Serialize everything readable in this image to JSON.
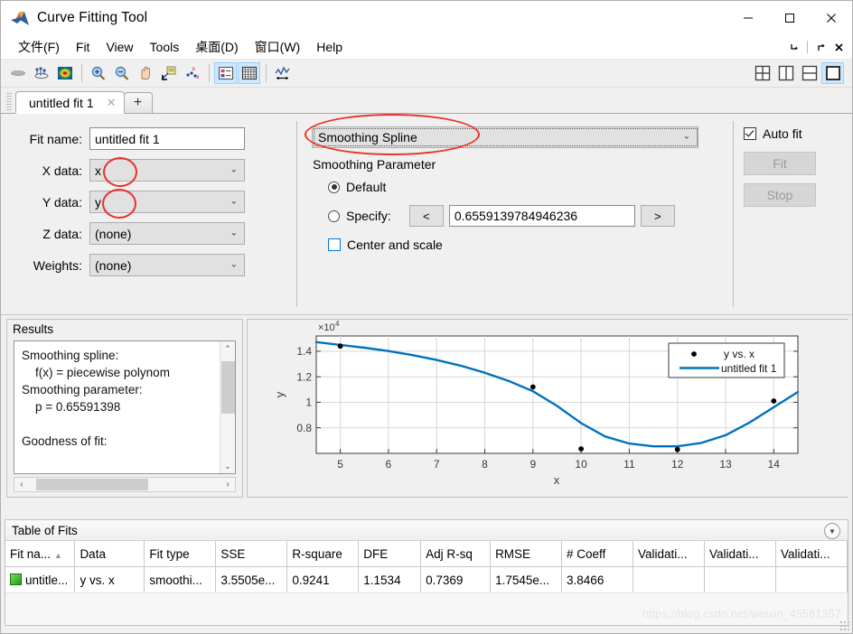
{
  "window": {
    "title": "Curve Fitting Tool",
    "icon": "matlab-icon",
    "minimize": "—",
    "maximize": "□",
    "close": "✕"
  },
  "menu": {
    "items": [
      {
        "label": "文件(F)",
        "name": "menu-file"
      },
      {
        "label": "Fit",
        "name": "menu-fit"
      },
      {
        "label": "View",
        "name": "menu-view"
      },
      {
        "label": "Tools",
        "name": "menu-tools"
      },
      {
        "label": "桌面(D)",
        "name": "menu-desktop"
      },
      {
        "label": "窗口(W)",
        "name": "menu-window"
      },
      {
        "label": "Help",
        "name": "menu-help"
      }
    ],
    "right_icons": [
      "dock-arrow-icon",
      "undock-arrow-icon",
      "close-icon"
    ]
  },
  "toolbar": {
    "buttons": [
      {
        "name": "surface-plot-button",
        "icon": "surface-icon",
        "active": false
      },
      {
        "name": "residuals-plot-button",
        "icon": "data-points-icon",
        "active": false
      },
      {
        "name": "contour-plot-button",
        "icon": "colormap-icon",
        "active": false
      },
      {
        "name": "zoom-in-button",
        "icon": "zoom-in-icon",
        "active": false
      },
      {
        "name": "zoom-out-button",
        "icon": "zoom-out-icon",
        "active": false
      },
      {
        "name": "pan-button",
        "icon": "hand-icon",
        "active": false
      },
      {
        "name": "data-cursor-button",
        "icon": "data-cursor-icon",
        "active": false
      },
      {
        "name": "exclude-outliers-button",
        "icon": "exclude-points-icon",
        "active": false
      },
      {
        "name": "legend-toggle-button",
        "icon": "legend-icon",
        "active": true
      },
      {
        "name": "grid-toggle-button",
        "icon": "grid-icon",
        "active": true
      },
      {
        "name": "axis-limits-button",
        "icon": "axis-limits-icon",
        "active": false
      }
    ],
    "layout_buttons": [
      {
        "name": "layout-four-panes-button",
        "icon": "layout-quad-icon",
        "active": false
      },
      {
        "name": "layout-two-columns-button",
        "icon": "layout-vsplit-icon",
        "active": false
      },
      {
        "name": "layout-two-rows-button",
        "icon": "layout-hsplit-icon",
        "active": false
      },
      {
        "name": "layout-single-pane-button",
        "icon": "layout-single-icon",
        "active": true
      }
    ]
  },
  "tabs": {
    "items": [
      {
        "label": "untitled fit 1",
        "close": "✕"
      }
    ],
    "add_label": "+"
  },
  "fit_form": {
    "fit_name_label": "Fit name:",
    "fit_name_value": "untitled fit 1",
    "x_data_label": "X data:",
    "x_data_value": "x",
    "y_data_label": "Y data:",
    "y_data_value": "y",
    "z_data_label": "Z data:",
    "z_data_value": "(none)",
    "weights_label": "Weights:",
    "weights_value": "(none)",
    "caret": "⌄"
  },
  "fit_options": {
    "fit_type": "Smoothing Spline",
    "caret": "⌄",
    "smoothing_parameter_title": "Smoothing Parameter",
    "default_label": "Default",
    "specify_label": "Specify:",
    "decrease_label": "<",
    "increase_label": ">",
    "parameter_value": "0.6559139784946236",
    "center_and_scale_label": "Center and scale",
    "default_selected": true,
    "center_and_scale_checked": false
  },
  "fit_controls": {
    "auto_fit_label": "Auto fit",
    "auto_fit_checked": true,
    "fit_button_label": "Fit",
    "stop_button_label": "Stop",
    "fit_enabled": false,
    "stop_enabled": false
  },
  "results": {
    "title": "Results",
    "text": "Smoothing spline:\n    f(x) = piecewise polynom\nSmoothing parameter:\n    p = 0.65591398\n\nGoodness of fit:",
    "scroll_up": "⌃",
    "scroll_down": "⌄",
    "scroll_left": "‹",
    "scroll_right": "›"
  },
  "table_of_fits": {
    "title": "Table of Fits",
    "collapse_icon": "chevron-down-icon",
    "columns": [
      "Fit na...",
      "Data",
      "Fit type",
      "SSE",
      "R-square",
      "DFE",
      "Adj R-sq",
      "RMSE",
      "# Coeff",
      "Validati...",
      "Validati...",
      "Validati..."
    ],
    "sorted_column_index": 0,
    "sort_caret": "▲",
    "rows": [
      {
        "cells": [
          "untitle...",
          "y vs. x",
          "smoothi...",
          "3.5505e...",
          "0.9241",
          "1.1534",
          "0.7369",
          "1.7545e...",
          "3.8466",
          "",
          "",
          ""
        ],
        "color_swatch": "#2bab2b"
      }
    ]
  },
  "watermark": {
    "text": "https://blog.csdn.net/weixin_45561357"
  },
  "chart_data": {
    "type": "scatter",
    "title": "",
    "xlabel": "x",
    "ylabel": "y",
    "y_exponent_label": "×10",
    "y_exponent_sup": "4",
    "xlim": [
      4.5,
      14.5
    ],
    "ylim": [
      6000,
      15200
    ],
    "xticks": [
      5,
      6,
      7,
      8,
      9,
      10,
      11,
      12,
      13,
      14
    ],
    "yticks": [
      8000,
      10000,
      12000,
      14000
    ],
    "ytick_labels": [
      "0.8",
      "1",
      "1.2",
      "1.4"
    ],
    "grid": true,
    "legend_position": "top-right",
    "series": [
      {
        "name": "y vs. x",
        "type": "scatter",
        "color": "#000000",
        "x": [
          5,
          9,
          10,
          12,
          14
        ],
        "y": [
          14700,
          11500,
          6650,
          6600,
          10400
        ]
      },
      {
        "name": "untitled fit 1",
        "type": "line",
        "color": "#0072BD",
        "x": [
          4.5,
          5,
          5.5,
          6,
          6.5,
          7,
          7.5,
          8,
          8.5,
          9,
          9.5,
          10,
          10.5,
          11,
          11.5,
          12,
          12.5,
          13,
          13.5,
          14,
          14.5
        ],
        "y": [
          15000,
          14780,
          14560,
          14300,
          13980,
          13600,
          13150,
          12600,
          11950,
          11150,
          10000,
          8650,
          7600,
          7050,
          6830,
          6830,
          7100,
          7700,
          8700,
          9900,
          11100
        ]
      }
    ]
  }
}
